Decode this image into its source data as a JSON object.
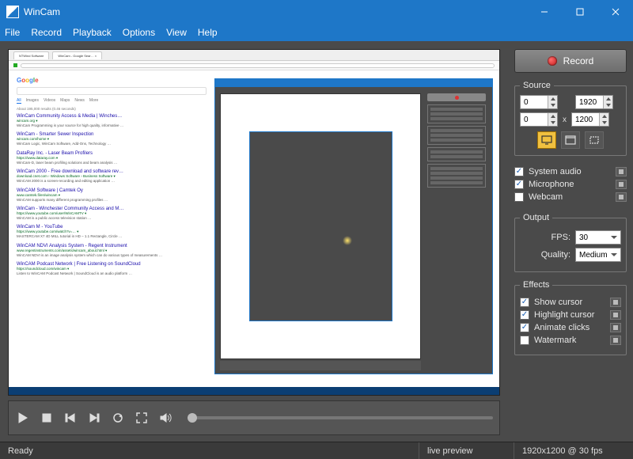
{
  "titlebar": {
    "title": "WinCam"
  },
  "menu": {
    "file": "File",
    "record": "Record",
    "playback": "Playback",
    "options": "Options",
    "view": "View",
    "help": "Help"
  },
  "transport": {
    "play": "Play",
    "stop": "Stop",
    "prev": "Previous frame",
    "next": "Next frame",
    "loop": "Loop",
    "fullscreen": "Fullscreen",
    "volume": "Volume"
  },
  "record_button": {
    "label": "Record"
  },
  "source": {
    "legend": "Source",
    "x1": "0",
    "y1": "0",
    "x2": "1920",
    "y2": "1200",
    "mode_fullscreen": "Full screen",
    "mode_window": "Window",
    "mode_region": "Region",
    "selected_mode": "fullscreen"
  },
  "audio": {
    "system": {
      "label": "System audio",
      "checked": true
    },
    "mic": {
      "label": "Microphone",
      "checked": true
    },
    "webcam": {
      "label": "Webcam",
      "checked": false
    }
  },
  "output": {
    "legend": "Output",
    "fps_label": "FPS:",
    "fps_value": "30",
    "quality_label": "Quality:",
    "quality_value": "Medium"
  },
  "effects": {
    "legend": "Effects",
    "show_cursor": {
      "label": "Show cursor",
      "checked": true
    },
    "highlight_cursor": {
      "label": "Highlight cursor",
      "checked": true
    },
    "animate_clicks": {
      "label": "Animate clicks",
      "checked": true
    },
    "watermark": {
      "label": "Watermark",
      "checked": false
    }
  },
  "status": {
    "ready": "Ready",
    "mode": "live preview",
    "dims": "1920x1200 @ 30 fps"
  },
  "preview": {
    "logo": "Google",
    "search_tabs": [
      "All",
      "Images",
      "Videos",
      "Maps",
      "News",
      "More"
    ],
    "count": "About 195,000 results (0.46 seconds)",
    "results": [
      {
        "t": "WinCam Community Access & Media | Winches…",
        "u": "wincam.org ▾",
        "d": "WinCam Programming is your source for high quality, informative …"
      },
      {
        "t": "WinCam - Smarter Sewer Inspection",
        "u": "wincam.com/home ▾",
        "d": "WinCam Logic, WinCam Software, Add-Ons, Technology …"
      },
      {
        "t": "DataRay Inc. - Laser Beam Profilers",
        "u": "https://www.dataray.com ▾",
        "d": "WinCam-D, laser beam profiling solutions and beam analysis …"
      },
      {
        "t": "WinCam 2000 - Free download and software rev…",
        "u": "download.cnet.com › Windows Software › Business Software ▾",
        "d": "WinCAM 2000 is a screen-recording and editing application …"
      },
      {
        "t": "WinCAM Software | Camtek Oy",
        "u": "www.camtek.fi/en/wincam ▾",
        "d": "WinCAM supports many different programming profiles …"
      },
      {
        "t": "WinCam - Winchester Community Access and M…",
        "u": "https://www.youtube.com/user/WinCAMTV ▾",
        "d": "WinCAM is a public access television station …"
      },
      {
        "t": "WinCam M - YouTube",
        "u": "https://www.youtube.com/watch?v=… ▾",
        "d": "MASTERCAM X7 4D MILL tutorial in HD – 1.1 Rectangle, Circle …"
      },
      {
        "t": "WinCAM NDVI Analysis System - Regent Instrument",
        "u": "www.regentinstruments.com/assets/wincam_about.html ▾",
        "d": "WinCAM NDVI is an image analysis system which can do various types of measurements …"
      },
      {
        "t": "WinCAM Podcast Network | Free Listening on SoundCloud",
        "u": "https://soundcloud.com/wincam ▾",
        "d": "Listen to WinCAM Podcast Network | SoundCloud is an audio platform …"
      }
    ]
  }
}
